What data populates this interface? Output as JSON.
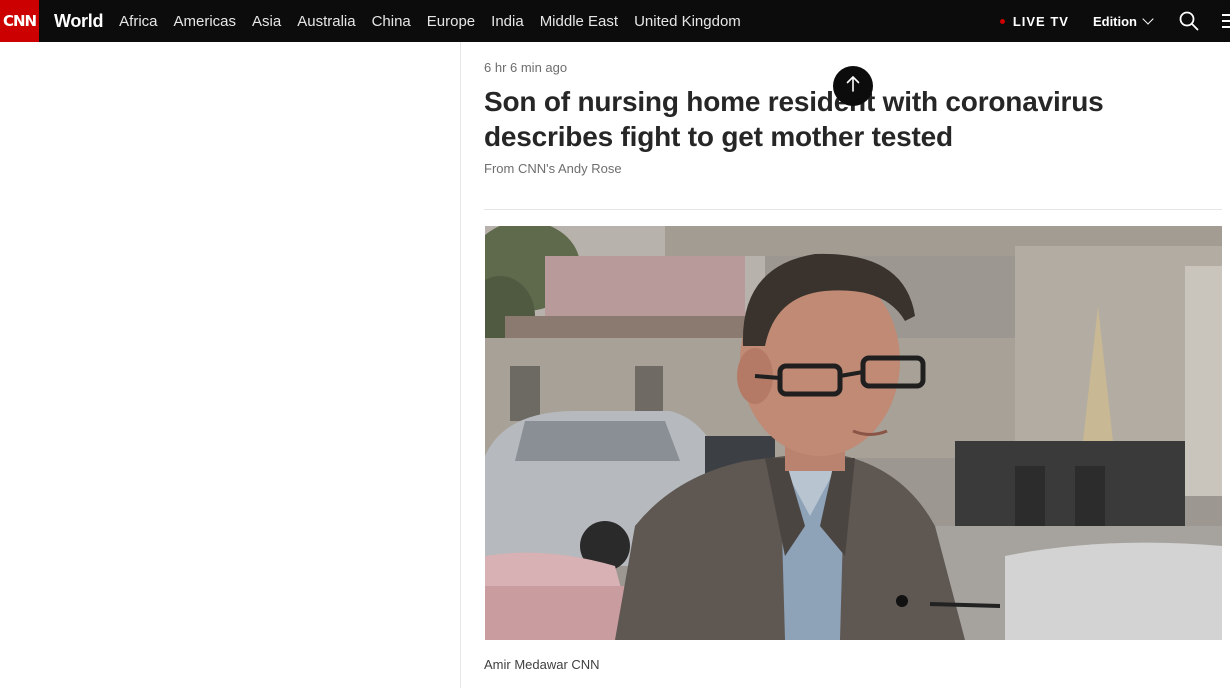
{
  "nav": {
    "logo_text": "CNN",
    "section": "World",
    "links": [
      "Africa",
      "Americas",
      "Asia",
      "Australia",
      "China",
      "Europe",
      "India",
      "Middle East",
      "United Kingdom"
    ],
    "live_tv": "LIVE TV",
    "edition": "Edition",
    "icons": {
      "search": "search-icon",
      "menu": "menu-icon",
      "edition": "chevron-down-icon",
      "scroll_top": "arrow-up-icon"
    }
  },
  "article": {
    "timestamp": "6 hr 6 min ago",
    "headline": "Son of nursing home resident with coronavirus describes fight to get mother tested",
    "byline": "From CNN's Andy Rose",
    "image_caption": "Amir Medawar CNN"
  },
  "colors": {
    "brand_red": "#cc0000",
    "nav_bg": "#0c0c0c",
    "text": "#262626",
    "muted": "#6e6e6e"
  }
}
